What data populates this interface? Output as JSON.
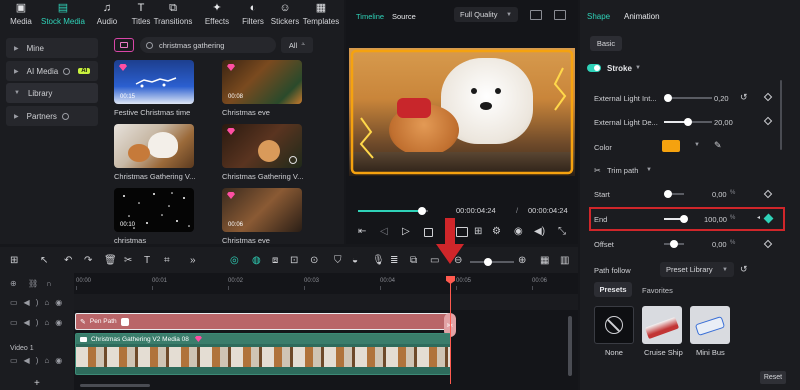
{
  "top_tabs": [
    {
      "label": "Media",
      "icon": "media-icon"
    },
    {
      "label": "Stock Media",
      "icon": "stock-media-icon",
      "active": true
    },
    {
      "label": "Audio",
      "icon": "audio-icon"
    },
    {
      "label": "Titles",
      "icon": "titles-icon"
    },
    {
      "label": "Transitions",
      "icon": "transitions-icon"
    },
    {
      "label": "Effects",
      "icon": "effects-icon"
    },
    {
      "label": "Filters",
      "icon": "filters-icon"
    },
    {
      "label": "Stickers",
      "icon": "stickers-icon"
    },
    {
      "label": "Templates",
      "icon": "templates-icon"
    }
  ],
  "sidebar": {
    "items": [
      {
        "label": "Mine"
      },
      {
        "label": "AI Media",
        "badge": "AI"
      },
      {
        "label": "Library"
      },
      {
        "label": "Partners"
      }
    ]
  },
  "search": {
    "query": "christmas gathering",
    "filter": "All"
  },
  "media_items": [
    {
      "caption": "Festive Christmas time",
      "duration": "00:15"
    },
    {
      "caption": "Christmas eve",
      "duration": "00:08"
    },
    {
      "caption": "Christmas Gathering V...",
      "duration": ""
    },
    {
      "caption": "Christmas Gathering V...",
      "duration": ""
    },
    {
      "caption": "christmas",
      "duration": "00:10"
    },
    {
      "caption": "Christmas eve",
      "duration": "00:06"
    }
  ],
  "preview": {
    "tab_timeline": "Timeline",
    "tab_source": "Source",
    "quality": "Full Quality",
    "current_time": "00:00:04:24",
    "separator": "/",
    "total_time": "00:00:04:24",
    "progress": 0.92
  },
  "properties": {
    "tab_shape": "Shape",
    "tab_animation": "Animation",
    "sub_basic": "Basic",
    "stroke_label": "Stroke",
    "rows": [
      {
        "label": "External Light Int...",
        "value": "0,20",
        "level": 0.05
      },
      {
        "label": "External Light De...",
        "value": "20,00",
        "level": 0.45
      }
    ],
    "color_label": "Color",
    "color_value": "#f5a20f",
    "trim_label": "Trim path",
    "trim_rows": [
      {
        "label": "Start",
        "value": "0,00",
        "unit": "%",
        "level": 0.0
      },
      {
        "label": "End",
        "value": "100,00",
        "unit": "%",
        "level": 1.0
      },
      {
        "label": "Offset",
        "value": "0,00",
        "unit": "%",
        "level": 0.5
      }
    ],
    "path_follow_label": "Path follow",
    "path_follow_value": "Preset Library",
    "tab_presets": "Presets",
    "tab_favorites": "Favorites",
    "presets": [
      {
        "label": "None"
      },
      {
        "label": "Cruise Ship"
      },
      {
        "label": "Mini Bus"
      }
    ],
    "reset_label": "Reset"
  },
  "timeline": {
    "ticks": [
      "00:00",
      "00:01",
      "00:02",
      "00:03",
      "00:04",
      "00:05",
      "00:06"
    ],
    "pen_clip_label": "Pen Path",
    "video_clip_label": "Christmas Gathering V2 Media 08",
    "track_label": "Video 1",
    "playhead_fraction": 0.75
  }
}
